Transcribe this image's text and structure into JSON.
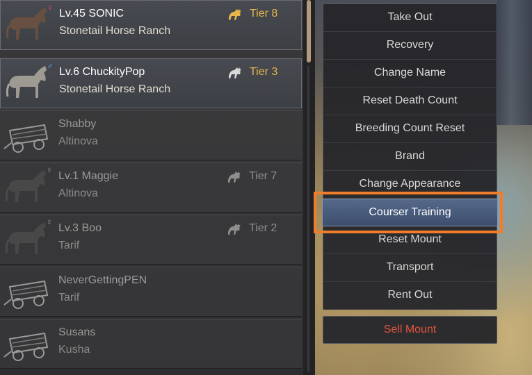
{
  "colors": {
    "name_bright": "#ffffff",
    "name_dim": "#9a9a9a",
    "tier_gold": "#e6b64a",
    "tier_dim": "#8e8e8e",
    "gender_female": "#e0476b",
    "gender_male": "#5aa0e0",
    "sell_red": "#e0553f",
    "highlight_orange": "#f07d2a"
  },
  "mounts": [
    {
      "name": "Lv.45 SONIC",
      "location": "Stonetail Horse Ranch",
      "tier": "Tier 8",
      "gender": "♀",
      "gender_kind": "female",
      "thumb": "horse-icon",
      "state": "active"
    },
    {
      "name": "Lv.6 ChuckityPop",
      "location": "Stonetail Horse Ranch",
      "tier": "Tier 3",
      "gender": "♂",
      "gender_kind": "male",
      "thumb": "horse-icon",
      "state": "active"
    },
    {
      "name": "Shabby",
      "location": "Altinova",
      "tier": "",
      "gender": "",
      "gender_kind": "",
      "thumb": "wagon-icon",
      "state": "dim"
    },
    {
      "name": "Lv.1 Maggie",
      "location": "Altinova",
      "tier": "Tier 7",
      "gender": "♀",
      "gender_kind": "neutral",
      "thumb": "horse-icon",
      "state": "dim"
    },
    {
      "name": "Lv.3 Boo",
      "location": "Tarif",
      "tier": "Tier 2",
      "gender": "♀",
      "gender_kind": "neutral",
      "thumb": "horse-icon",
      "state": "dim"
    },
    {
      "name": "NeverGettingPEN",
      "location": "Tarif",
      "tier": "",
      "gender": "",
      "gender_kind": "",
      "thumb": "wagon-icon",
      "state": "dim"
    },
    {
      "name": "Susans",
      "location": "Kusha",
      "tier": "",
      "gender": "",
      "gender_kind": "",
      "thumb": "wagon-icon",
      "state": "dim"
    }
  ],
  "menu": {
    "items": [
      "Take Out",
      "Recovery",
      "Change Name",
      "Reset Death Count",
      "Breeding Count Reset",
      "Brand",
      "Change Appearance",
      "Courser Training",
      "Reset Mount",
      "Transport",
      "Rent Out"
    ],
    "highlighted": "Courser Training",
    "sell": "Sell Mount"
  }
}
